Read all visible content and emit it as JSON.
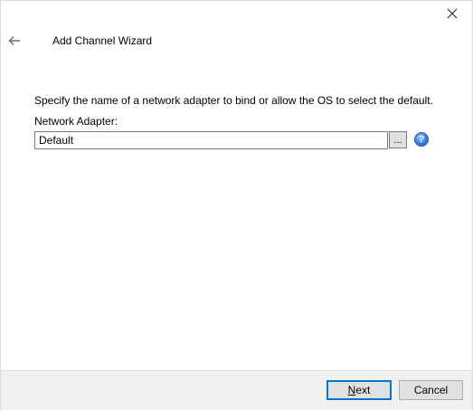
{
  "window": {
    "title": "Add Channel Wizard",
    "close_icon": "close-icon",
    "back_icon": "back-arrow-icon"
  },
  "content": {
    "description": "Specify the name of a network adapter to bind or allow the OS to select the default.",
    "adapter_label": "Network Adapter:",
    "adapter_value": "Default",
    "browse_label": "...",
    "help_icon": "help-icon",
    "help_glyph": "?"
  },
  "footer": {
    "next_mnemonic": "N",
    "next_rest": "ext",
    "cancel_label": "Cancel"
  },
  "colors": {
    "accent": "#0078d7",
    "footer_bg": "#f0f0f0",
    "button_bg": "#e1e1e1"
  }
}
